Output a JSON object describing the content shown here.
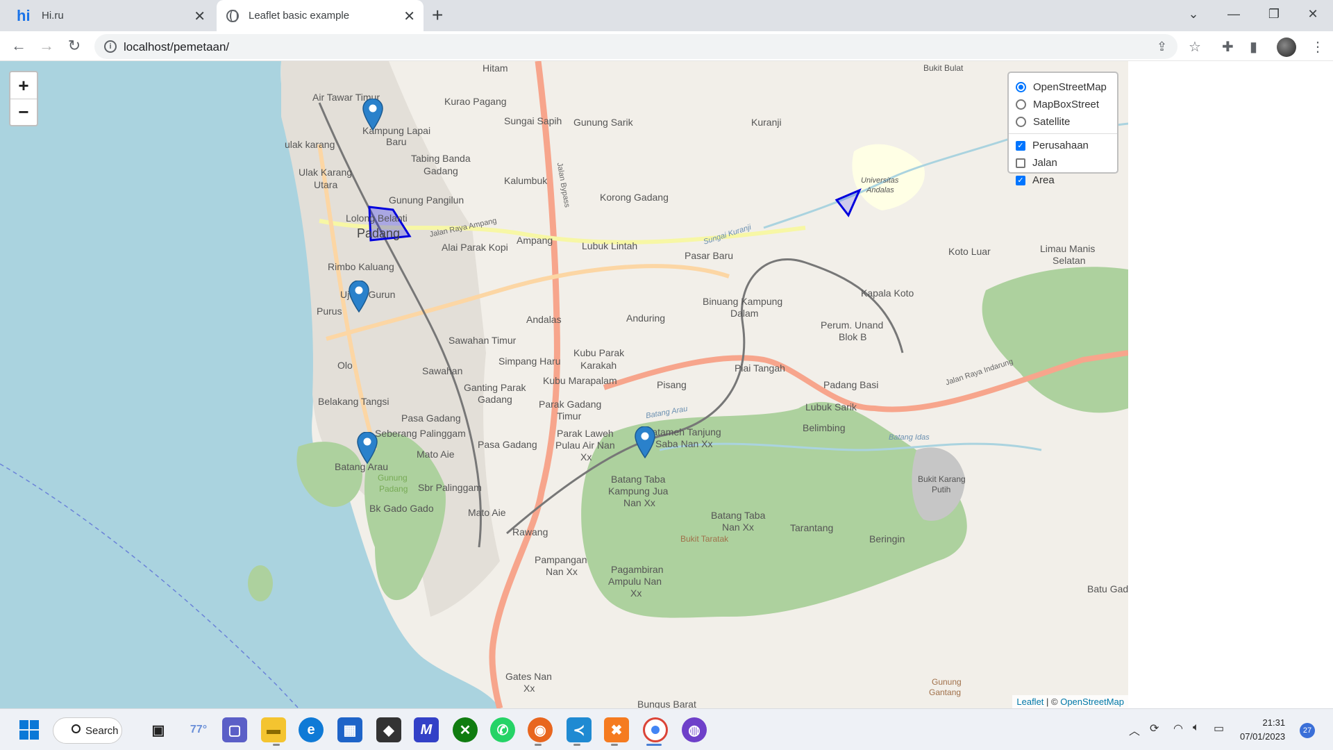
{
  "browser": {
    "tabs": [
      {
        "title": "Hi.ru",
        "favicon": "hi-icon"
      },
      {
        "title": "Leaflet basic example",
        "favicon": "globe-icon"
      }
    ],
    "url": "localhost/pemetaan/"
  },
  "map": {
    "zoom_in": "+",
    "zoom_out": "−",
    "base_layers": [
      {
        "label": "OpenStreetMap",
        "selected": true
      },
      {
        "label": "MapBoxStreet",
        "selected": false
      },
      {
        "label": "Satellite",
        "selected": false
      }
    ],
    "overlays": [
      {
        "label": "Perusahaan",
        "checked": true
      },
      {
        "label": "Jalan",
        "checked": false
      },
      {
        "label": "Area",
        "checked": true
      }
    ],
    "attribution": {
      "leaflet": "Leaflet",
      "separator": " | © ",
      "osm": "OpenStreetMap"
    },
    "labels": [
      "Hitam",
      "Bukit Bulat",
      "Air Tawar Timur",
      "Kurao Pagang",
      "Kampung Lapai",
      "Baru",
      "Sungai Sapih",
      "Gunung Sarik",
      "Kuranji",
      "ulak karang",
      "Tabing Banda",
      "Gadang",
      "Ulak Karang",
      "Utara",
      "Kalumbuk",
      "Universitas",
      "Andalas",
      "Gunung Pangilun",
      "Korong Gadang",
      "Lolong Belanti",
      "Padang",
      "Jalan Raya Ampang",
      "Alai Parak Kopi",
      "Ampang",
      "Lubuk Lintah",
      "Pasar Baru",
      "Koto Luar",
      "Limau Manis",
      "Selatan",
      "Rimbo Kaluang",
      "Ujung Gurun",
      "Purus",
      "Kapala Koto",
      "Binuang Kampung",
      "Dalam",
      "Andalas",
      "Anduring",
      "Perum. Unand",
      "Blok B",
      "Sawahan Timur",
      "Kubu Parak",
      "Karakah",
      "Olo",
      "Simpang Haru",
      "Sawahan",
      "Kubu Marapalam",
      "Piai Tangah",
      "Pisang",
      "Padang Basi",
      "Ganting Parak",
      "Gadang",
      "Belakang Tangsi",
      "Parak Gadang",
      "Timur",
      "Lubuk Sarik",
      "Pasa Gadang",
      "Belimbing",
      "Seberang Palinggam",
      "Parak Laweh",
      "Pulau Air Nan",
      "Xx",
      "Batameh Tanjung",
      "Saba Nan Xx",
      "Pasa Gadang",
      "Mato Aie",
      "Batang Arau",
      "Gunung",
      "Padang",
      "Sbr Palinggam",
      "Batang Taba",
      "Kampung Jua",
      "Nan Xx",
      "Bukit Karang",
      "Putih",
      "Bk Gado Gado",
      "Mato Aie",
      "Batang Taba",
      "Nan Xx",
      "Tarantang",
      "Bukit Taratak",
      "Beringin",
      "Rawang",
      "Pampangan",
      "Nan Xx",
      "Pagambiran",
      "Ampulu Nan",
      "Xx",
      "Batu Gad",
      "Gates Nan",
      "Xx",
      "Bungus Barat",
      "Gunung",
      "Gantang",
      "Jalan Raya Indarung",
      "Jalan Bypass",
      "Batang Idas",
      "Batang Arau",
      "Sungai Kuranji"
    ]
  },
  "taskbar": {
    "search": "Search",
    "weather": "77°",
    "time": "21:31",
    "date": "07/01/2023",
    "notifications": "27"
  }
}
